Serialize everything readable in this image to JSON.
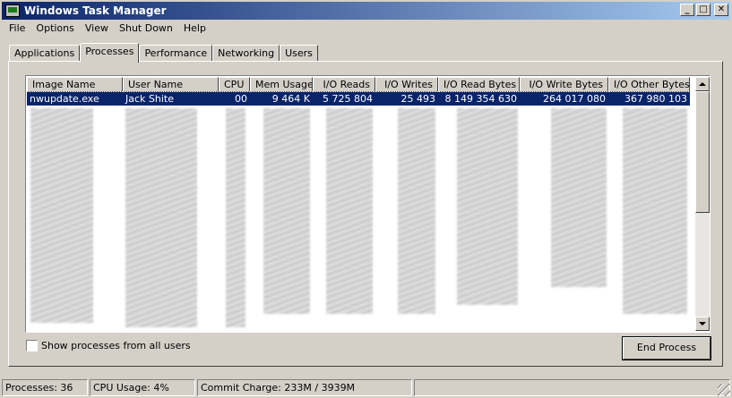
{
  "window": {
    "title": "Windows Task Manager",
    "buttons": {
      "minimize": "_",
      "maximize": "□",
      "close": "✕"
    }
  },
  "menu": [
    "File",
    "Options",
    "View",
    "Shut Down",
    "Help"
  ],
  "tabs": [
    "Applications",
    "Processes",
    "Performance",
    "Networking",
    "Users"
  ],
  "active_tab": "Processes",
  "processes": {
    "columns": [
      "Image Name",
      "User Name",
      "CPU",
      "Mem Usage",
      "I/O Reads",
      "I/O Writes",
      "I/O Read Bytes",
      "I/O Write Bytes",
      "I/O Other Bytes"
    ],
    "rows": [
      {
        "image_name": "nwupdate.exe",
        "user_name": "Jack Shite",
        "cpu": "00",
        "mem_usage": "9 464 K",
        "io_reads": "5 725 804",
        "io_writes": "25 493",
        "io_read_bytes": "8 149 354 630",
        "io_write_bytes": "264 017 080",
        "io_other_bytes": "367 980 103"
      }
    ]
  },
  "show_all_users": {
    "label": "Show processes from all users",
    "checked": false
  },
  "end_process_label": "End Process",
  "status": {
    "processes": "Processes: 36",
    "cpu_usage": "CPU Usage: 4%",
    "commit_charge": "Commit Charge: 233M / 3939M"
  },
  "colors": {
    "title_start": "#0a246a",
    "title_end": "#a6caf0",
    "selection": "#0a246a",
    "face": "#d4d0c8"
  }
}
